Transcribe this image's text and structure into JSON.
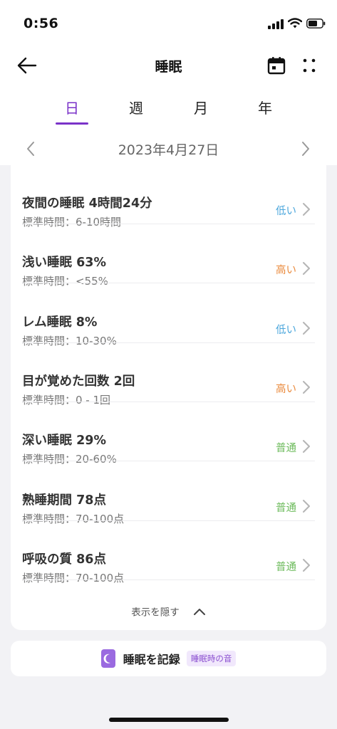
{
  "status_bar": {
    "time": "0:56"
  },
  "header": {
    "title": "睡眠"
  },
  "tabs": [
    {
      "label": "日",
      "active": true
    },
    {
      "label": "週",
      "active": false
    },
    {
      "label": "月",
      "active": false
    },
    {
      "label": "年",
      "active": false
    }
  ],
  "date": "2023年4月27日",
  "metrics": [
    {
      "title": "夜間の睡眠 4時間24分",
      "range": "標準時間：6-10時間",
      "status": "低い",
      "level": "low"
    },
    {
      "title": "浅い睡眠 63%",
      "range": "標準時間：<55%",
      "status": "高い",
      "level": "high"
    },
    {
      "title": "レム睡眠 8%",
      "range": "標準時間：10-30%",
      "status": "低い",
      "level": "low"
    },
    {
      "title": "目が覚めた回数 2回",
      "range": "標準時間：0 - 1回",
      "status": "高い",
      "level": "high"
    },
    {
      "title": "深い睡眠 29%",
      "range": "標準時間：20-60%",
      "status": "普通",
      "level": "normal"
    },
    {
      "title": "熟睡期間 78点",
      "range": "標準時間：70-100点",
      "status": "普通",
      "level": "normal"
    },
    {
      "title": "呼吸の質 86点",
      "range": "標準時間：70-100点",
      "status": "普通",
      "level": "normal"
    }
  ],
  "hide_label": "表示を隠す",
  "record": {
    "label": "睡眠を記録",
    "badge": "睡眠時の音"
  },
  "colors": {
    "accent": "#7a32c8",
    "low": "#4aa6dc",
    "high": "#ea8a3c",
    "normal": "#6dbb5c"
  }
}
